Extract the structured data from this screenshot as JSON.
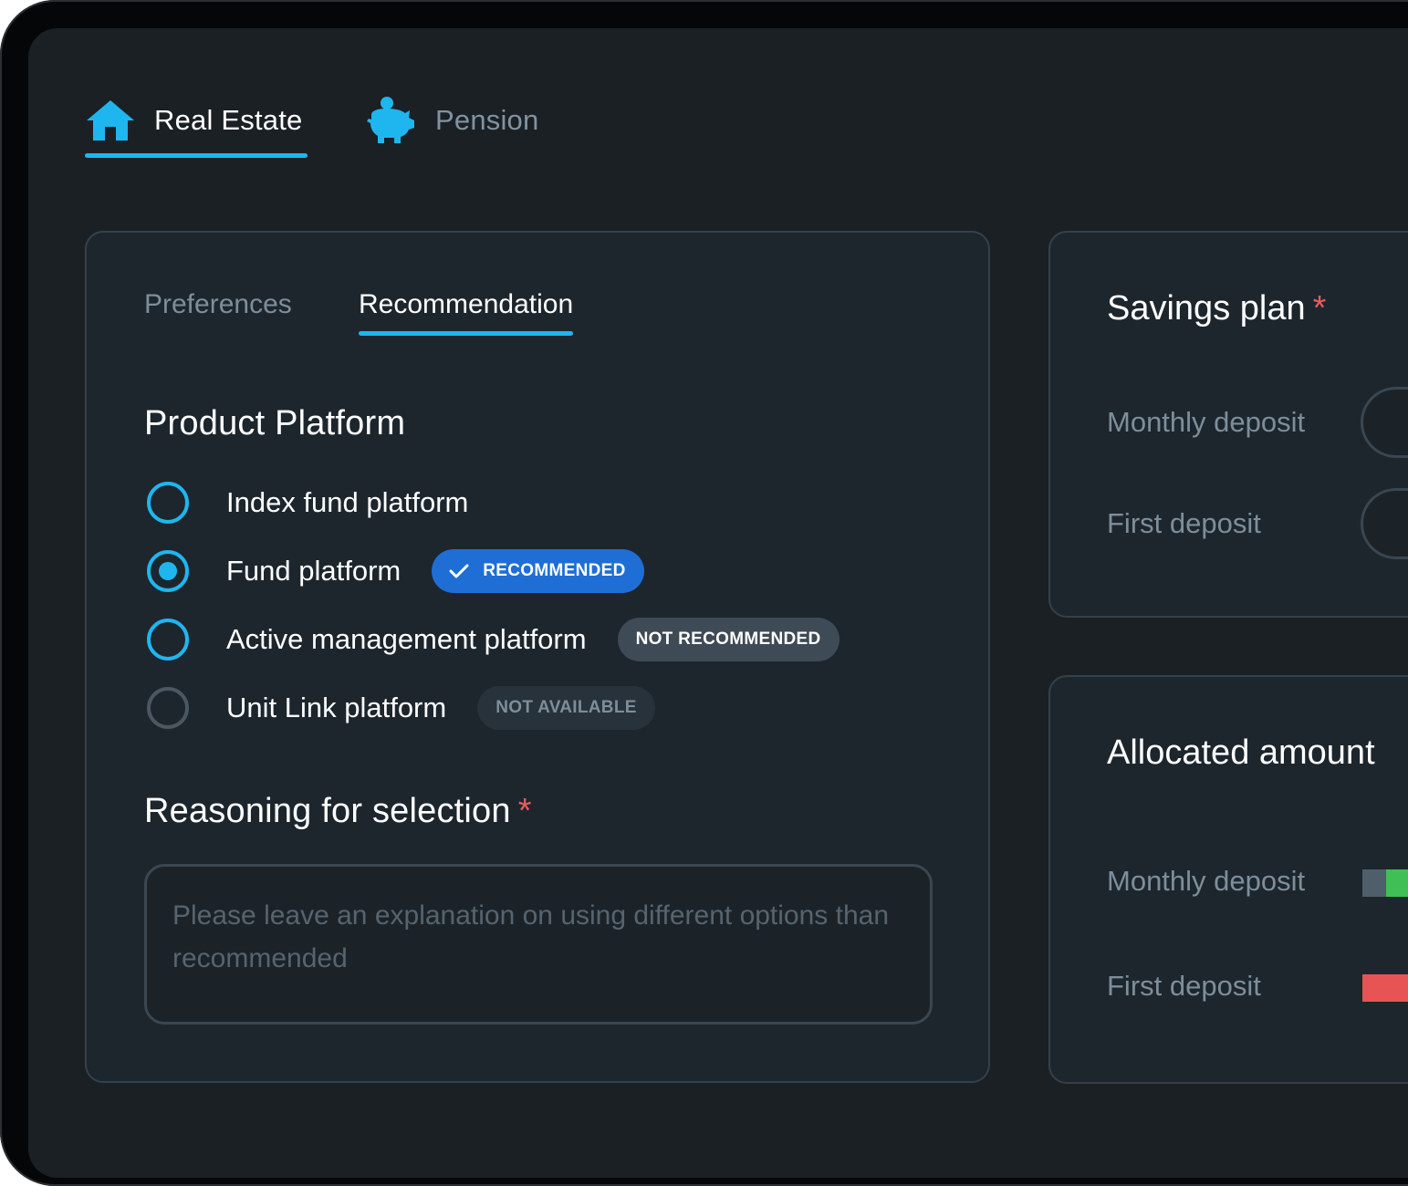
{
  "top_tabs": [
    {
      "label": "Real Estate",
      "icon": "house-icon",
      "active": true
    },
    {
      "label": "Pension",
      "icon": "piggy-bank-icon",
      "active": false
    }
  ],
  "main_card": {
    "sub_tabs": [
      {
        "label": "Preferences",
        "active": false
      },
      {
        "label": "Recommendation",
        "active": true
      }
    ],
    "product_platform": {
      "title": "Product Platform",
      "options": [
        {
          "label": "Index fund platform",
          "state": "unchecked",
          "badge": ""
        },
        {
          "label": "Fund platform",
          "state": "checked",
          "badge": "RECOMMENDED"
        },
        {
          "label": "Active management platform",
          "state": "unchecked",
          "badge": "NOT RECOMMENDED"
        },
        {
          "label": "Unit Link platform",
          "state": "disabled",
          "badge": "NOT AVAILABLE"
        }
      ]
    },
    "reasoning": {
      "title": "Reasoning for selection",
      "required_marker": "*",
      "placeholder": "Please leave an explanation on using different options than recommended",
      "value": ""
    }
  },
  "savings_plan": {
    "title": "Savings plan",
    "required_marker": "*",
    "fields": [
      {
        "label": "Monthly deposit"
      },
      {
        "label": "First deposit"
      }
    ]
  },
  "allocated_amount": {
    "title": "Allocated amount",
    "rows": [
      {
        "label": "Monthly deposit",
        "bar_colors": [
          "#4e5e6a",
          "#3fbf55"
        ]
      },
      {
        "label": "First deposit",
        "bar_colors": [
          "#e85454"
        ]
      }
    ]
  },
  "colors": {
    "accent": "#1fb6ef",
    "recommended": "#1e6ed6",
    "required": "#e85c5c"
  }
}
